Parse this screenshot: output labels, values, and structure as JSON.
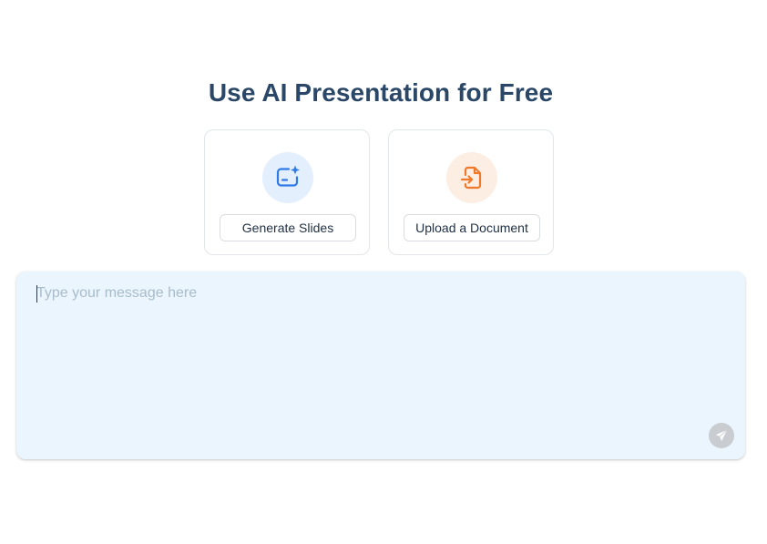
{
  "heading": {
    "title": "Use AI Presentation for Free"
  },
  "options": [
    {
      "label": "Generate Slides",
      "icon": "slides-sparkle-icon",
      "accent_color": "#2f7ae5",
      "icon_bg": "#e3effd"
    },
    {
      "label": "Upload a Document",
      "icon": "file-import-icon",
      "accent_color": "#f07a2c",
      "icon_bg": "#fdeee3"
    }
  ],
  "composer": {
    "placeholder": "Type your message here",
    "value": "",
    "send_icon": "paper-plane-icon",
    "background": "#eaf5fd"
  }
}
